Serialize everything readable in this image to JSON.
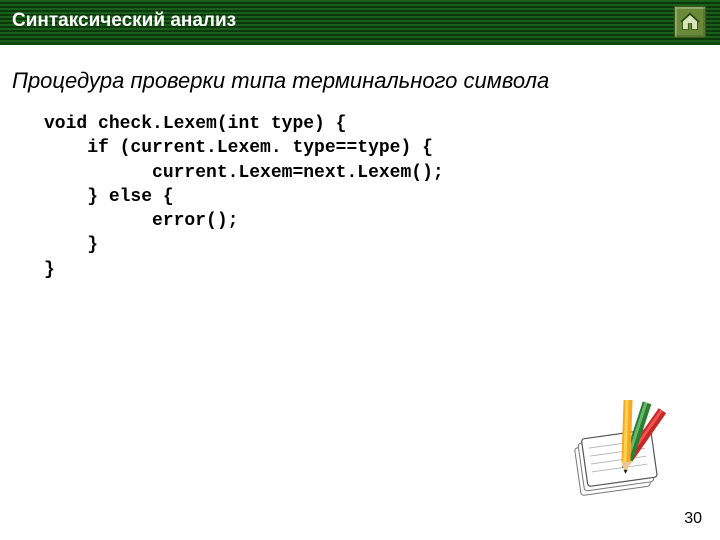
{
  "header": {
    "title": "Синтаксический анализ",
    "home_icon": "home-icon"
  },
  "subtitle": "Процедура проверки типа терминального символа",
  "code": {
    "line1_kw": "void",
    "line1_rest": " check.Lexem(int type) {",
    "line2_kw": "if",
    "line2_rest": " (current.Lexem. type==type) {",
    "line3": "current.Lexem=next.Lexem();",
    "line4a": "} ",
    "line4_kw": "else",
    "line4b": " {",
    "line5": "error();",
    "line6": "}",
    "line7": "}"
  },
  "page_number": "30"
}
